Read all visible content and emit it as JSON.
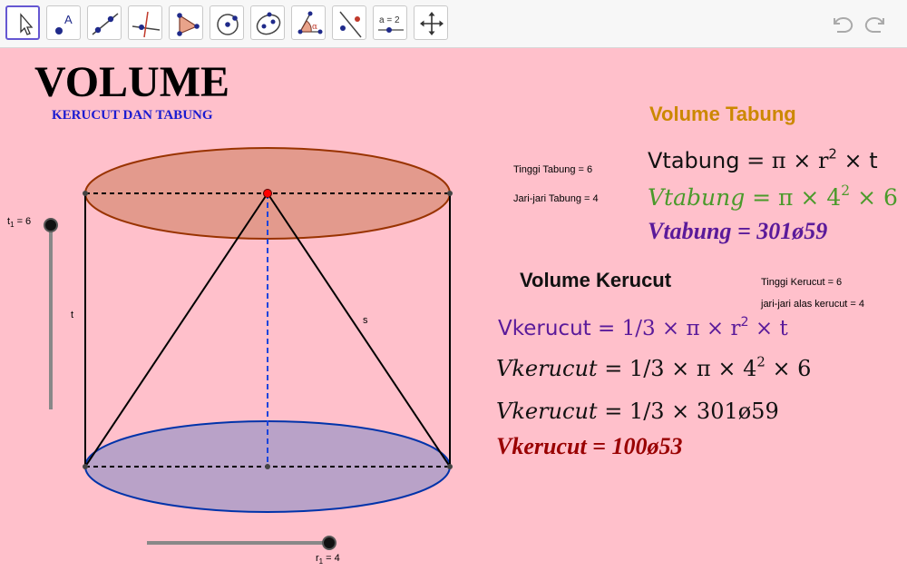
{
  "toolbar": {
    "tools": [
      {
        "name": "move-tool",
        "active": true
      },
      {
        "name": "point-tool",
        "label": "A"
      },
      {
        "name": "line-tool"
      },
      {
        "name": "perpendicular-tool"
      },
      {
        "name": "polygon-tool"
      },
      {
        "name": "circle-tool"
      },
      {
        "name": "conic-tool"
      },
      {
        "name": "angle-tool",
        "label": "α"
      },
      {
        "name": "reflect-tool"
      },
      {
        "name": "slider-tool",
        "label": "a = 2"
      },
      {
        "name": "move-view-tool"
      }
    ],
    "undo_icon": "undo-arrow",
    "redo_icon": "redo-arrow"
  },
  "title": {
    "main": "VOLUME",
    "subtitle": "KERUCUT DAN TABUNG"
  },
  "figure": {
    "label_t": "t",
    "label_s": "s",
    "slider_t1": {
      "label": "t",
      "sub": "1",
      "value_text": " = 6",
      "value": 6
    },
    "slider_r1": {
      "label": "r",
      "sub": "1",
      "value_text": " = 4",
      "value": 4
    },
    "colors": {
      "top_fill": "#e39a8d",
      "top_stroke": "#993300",
      "bottom_fill": "#b9a2c8",
      "bottom_stroke": "#0033aa",
      "apex": "#ff0000",
      "axis": "#1a44dd"
    }
  },
  "tabung": {
    "heading": "Volume Tabung",
    "heading_color": "#cc8800",
    "tinggi": "Tinggi Tabung = 6",
    "jari": "Jari-jari Tabung = 4",
    "f1": {
      "lhs": "Vtabung",
      "rhs": " = π × r",
      "exp": "2",
      "tail": " × t"
    },
    "f2": {
      "lhs": "Vtabung",
      "rhs": " = π × 4",
      "exp": "2",
      "tail": " × 6",
      "color": "#4a9a2a"
    },
    "f3": {
      "text": "Vtabung = 301ø59",
      "color": "#5a1a9a"
    }
  },
  "kerucut": {
    "heading": "Volume Kerucut",
    "tinggi": "Tinggi Kerucut = 6",
    "jari": "jari-jari alas kerucut = 4",
    "f1": {
      "lhs": "Vkerucut",
      "rhs": " = 1/3 × π × r",
      "exp": "2",
      "tail": " × t",
      "color": "#5a1a9a"
    },
    "f2": {
      "lhs": "Vkerucut",
      "rhs": " = 1/3 × π × 4",
      "exp": "2",
      "tail": " × 6"
    },
    "f3": {
      "lhs": "Vkerucut",
      "rhs": " = 1/3 × 301ø59"
    },
    "f4": {
      "text": "Vkerucut = 100ø53",
      "color": "#990000"
    }
  }
}
